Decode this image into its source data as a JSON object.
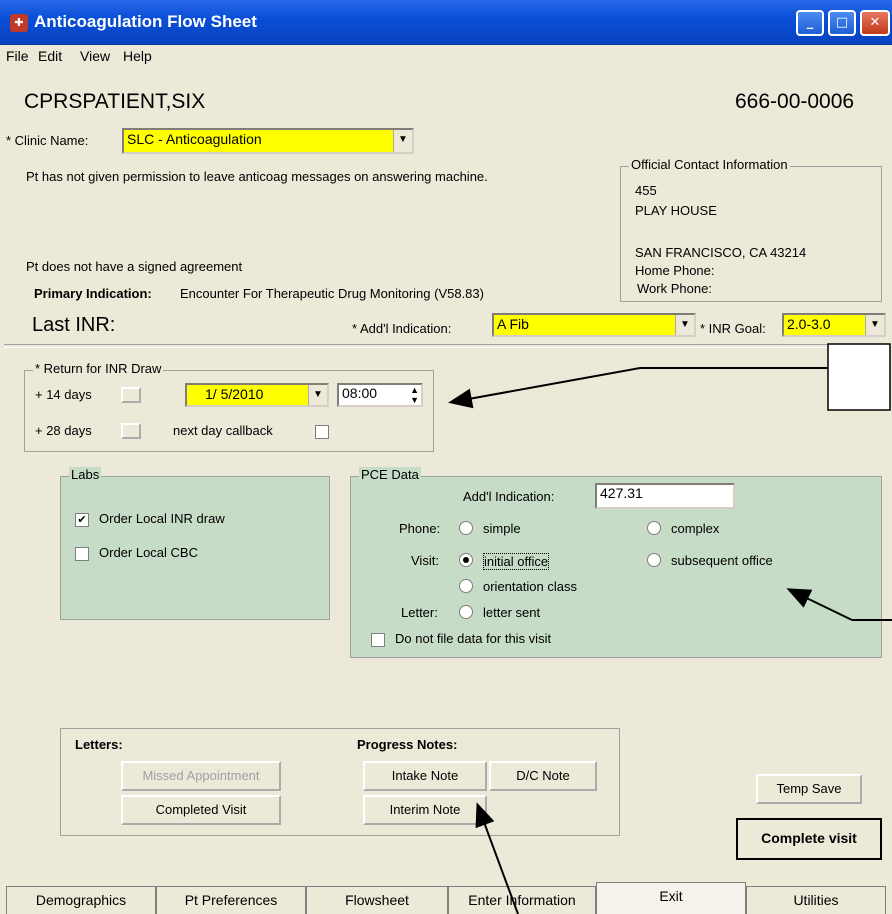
{
  "window": {
    "title": "Anticoagulation Flow Sheet",
    "icon": "app-icon"
  },
  "menu": [
    "File",
    "Edit",
    "View",
    "Help"
  ],
  "patient": {
    "name": "CPRSPATIENT,SIX",
    "ssn": "666-00-0006"
  },
  "clinic": {
    "label": "* Clinic Name:",
    "value": "SLC - Anticoagulation"
  },
  "messages": {
    "permission": "Pt has not given permission to leave anticoag messages on answering machine.",
    "agreement": "Pt does not have a signed agreement"
  },
  "primary_indication": {
    "label": "Primary Indication:",
    "value": "Encounter For Therapeutic Drug Monitoring (V58.83)"
  },
  "contact": {
    "title": "Official Contact Information",
    "line1": "455",
    "line2": "PLAY HOUSE",
    "line3": "SAN FRANCISCO,  CA  43214",
    "home_phone": "Home Phone:",
    "work_phone": "Work Phone:"
  },
  "last_inr": "Last INR:",
  "addl_indication": {
    "label": "* Add'l Indication:",
    "value": "A Fib"
  },
  "inr_goal": {
    "label": "* INR Goal:",
    "value": "2.0-3.0"
  },
  "return_draw": {
    "title": "* Return for INR Draw",
    "plus14": "+ 14 days",
    "plus28": "+ 28 days",
    "date": "1/ 5/2010",
    "time": "08:00",
    "next_day": "next day callback"
  },
  "labs": {
    "title": "Labs",
    "order_inr": "Order Local INR draw",
    "order_inr_checked": true,
    "order_cbc": "Order Local CBC",
    "order_cbc_checked": false
  },
  "pce": {
    "title": "PCE Data",
    "addl_label": "Add'l Indication:",
    "addl_value": "427.31",
    "phone_label": "Phone:",
    "simple": "simple",
    "complex": "complex",
    "visit_label": "Visit:",
    "initial": "initial office",
    "subsequent": "subsequent office",
    "orientation": "orientation class",
    "letter_label": "Letter:",
    "letter_sent": "letter sent",
    "do_not_file": "Do not file data for this visit"
  },
  "letters": {
    "title": "Letters:",
    "missed": "Missed Appointment",
    "completed": "Completed Visit"
  },
  "progress": {
    "title": "Progress Notes:",
    "intake": "Intake Note",
    "dc": "D/C Note",
    "interim": "Interim Note"
  },
  "actions": {
    "temp_save": "Temp Save",
    "complete": "Complete visit"
  },
  "tabs": [
    "Demographics",
    "Pt Preferences",
    "Flowsheet",
    "Enter Information",
    "Exit",
    "Utilities"
  ]
}
